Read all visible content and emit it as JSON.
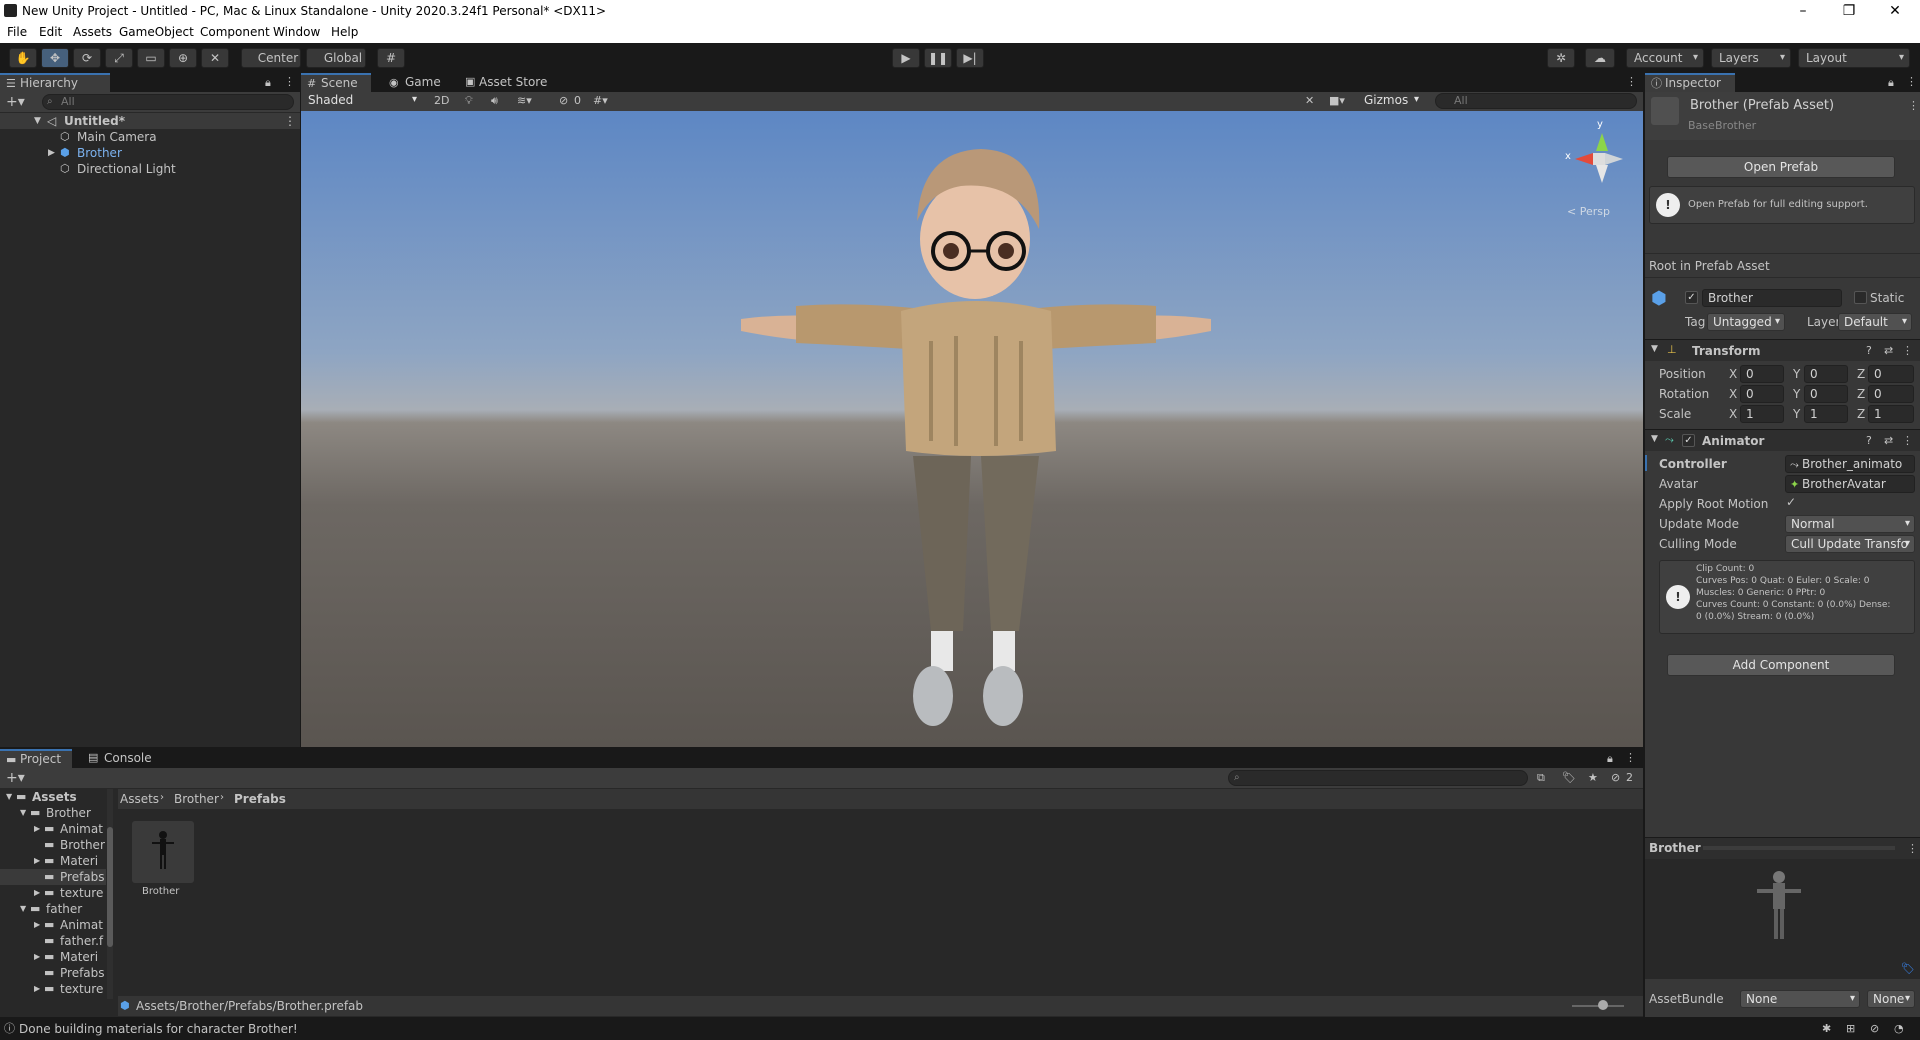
{
  "window": {
    "title": "New Unity Project - Untitled - PC, Mac & Linux Standalone - Unity 2020.3.24f1 Personal* <DX11>",
    "minimize": "–",
    "maximize": "❐",
    "close": "✕"
  },
  "menu": [
    "File",
    "Edit",
    "Assets",
    "GameObject",
    "Component",
    "Window",
    "Help"
  ],
  "toolbar": {
    "pivot": "Center",
    "space": "Global",
    "account": "Account",
    "layers": "Layers",
    "layout": "Layout"
  },
  "hierarchy": {
    "tab": "Hierarchy",
    "search_placeholder": "All",
    "scene_name": "Untitled*",
    "items": [
      "Main Camera",
      "Brother",
      "Directional Light"
    ]
  },
  "scene": {
    "tabs": [
      "Scene",
      "Game",
      "Asset Store"
    ],
    "shading": "Shaded",
    "mode_2d": "2D",
    "hidden_count": "0",
    "gizmos": "Gizmos",
    "search_placeholder": "All",
    "persp": "< Persp",
    "axis_x": "x",
    "axis_y": "y"
  },
  "project": {
    "tabs": [
      "Project",
      "Console"
    ],
    "breadcrumb": [
      "Assets",
      "Brother",
      "Prefabs"
    ],
    "hidden_count": "2",
    "tree": [
      {
        "label": "Assets",
        "depth": 0,
        "expanded": true
      },
      {
        "label": "Brother",
        "depth": 1,
        "expanded": true
      },
      {
        "label": "Animat",
        "depth": 2
      },
      {
        "label": "Brother",
        "depth": 2
      },
      {
        "label": "Materi",
        "depth": 2
      },
      {
        "label": "Prefabs",
        "depth": 2,
        "selected": true
      },
      {
        "label": "texture",
        "depth": 2
      },
      {
        "label": "father",
        "depth": 1,
        "expanded": true
      },
      {
        "label": "Animat",
        "depth": 2
      },
      {
        "label": "father.f",
        "depth": 2
      },
      {
        "label": "Materi",
        "depth": 2
      },
      {
        "label": "Prefabs",
        "depth": 2
      },
      {
        "label": "texture",
        "depth": 2
      }
    ],
    "asset_name": "Brother",
    "path": "Assets/Brother/Prefabs/Brother.prefab"
  },
  "inspector": {
    "tab": "Inspector",
    "asset_title": "Brother (Prefab Asset)",
    "base_label": "Base",
    "base_value": "Brother",
    "open_prefab": "Open Prefab",
    "open_prefab_info": "Open Prefab for full editing support.",
    "root_label": "Root in Prefab Asset",
    "object_name": "Brother",
    "static_label": "Static",
    "tag_label": "Tag",
    "tag_value": "Untagged",
    "layer_label": "Layer",
    "layer_value": "Default",
    "transform": {
      "title": "Transform",
      "rows": [
        {
          "label": "Position",
          "x": "0",
          "y": "0",
          "z": "0"
        },
        {
          "label": "Rotation",
          "x": "0",
          "y": "0",
          "z": "0"
        },
        {
          "label": "Scale",
          "x": "1",
          "y": "1",
          "z": "1"
        }
      ]
    },
    "animator": {
      "title": "Animator",
      "controller_label": "Controller",
      "controller_value": "Brother_animato",
      "avatar_label": "Avatar",
      "avatar_value": "BrotherAvatar",
      "root_motion_label": "Apply Root Motion",
      "update_mode_label": "Update Mode",
      "update_mode_value": "Normal",
      "culling_mode_label": "Culling Mode",
      "culling_mode_value": "Cull Update Transfo",
      "info": [
        "Clip Count: 0",
        "Curves Pos: 0 Quat: 0 Euler: 0 Scale: 0",
        "Muscles: 0 Generic: 0 PPtr: 0",
        "Curves Count: 0 Constant: 0 (0.0%) Dense:",
        "0 (0.0%) Stream: 0 (0.0%)"
      ]
    },
    "add_component": "Add Component",
    "preview_title": "Brother",
    "assetbundle_label": "AssetBundle",
    "assetbundle_value": "None",
    "assetbundle_variant": "None"
  },
  "status": {
    "message": "Done building materials for character Brother!"
  }
}
